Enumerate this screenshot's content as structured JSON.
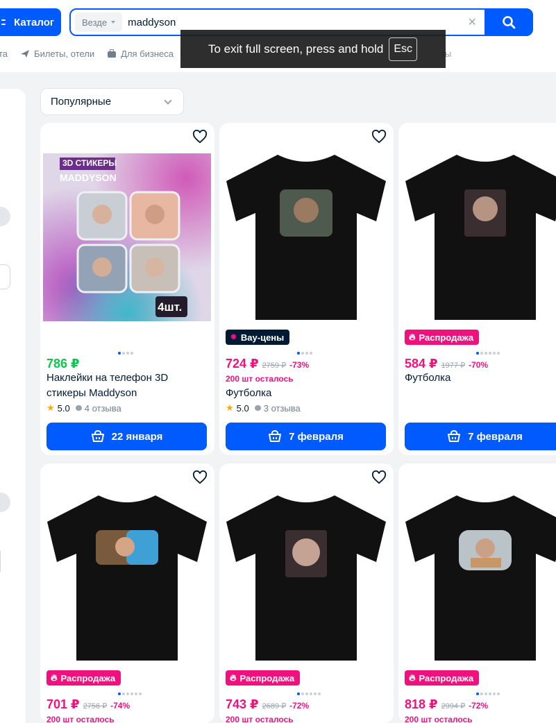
{
  "header": {
    "catalog_label": "Каталог",
    "search_scope": "Везде",
    "search_value": "maddyson"
  },
  "nav": {
    "items": [
      {
        "label": "та",
        "icon": "cut-off-item"
      },
      {
        "label": "Билеты, отели",
        "icon": "plane-icon"
      },
      {
        "label": "Для бизнеса",
        "icon": "briefcase-icon"
      }
    ],
    "far_right": "ты"
  },
  "overlay": {
    "message": "To exit full screen, press and hold",
    "key": "Esc"
  },
  "sort": {
    "label": "Популярные"
  },
  "cards": [
    {
      "price": "786 ₽",
      "title": "Наклейки на телефон 3D стикеры Maddyson",
      "rating": "5.0",
      "reviews": "4 отзыва",
      "delivery": "22 января",
      "image_title": "3D СТИКЕРЫ",
      "image_subtitle": "MADDYSON",
      "image_badge": "4шт."
    },
    {
      "badge": "Вау-цены",
      "price": "724 ₽",
      "old_price": "2759 ₽",
      "discount": "-73%",
      "stock": "200 шт осталось",
      "title": "Футболка",
      "rating": "5.0",
      "reviews": "3 отзыва",
      "delivery": "7 февраля"
    },
    {
      "badge": "Распродажа",
      "price": "584 ₽",
      "old_price": "1977 ₽",
      "discount": "-70%",
      "title": "Футболка",
      "delivery": "7 февраля"
    },
    {
      "badge": "Распродажа",
      "price": "701 ₽",
      "old_price": "2756 ₽",
      "discount": "-74%",
      "stock": "200 шт осталось"
    },
    {
      "badge": "Распродажа",
      "price": "743 ₽",
      "old_price": "2689 ₽",
      "discount": "-72%",
      "stock": "200 шт осталось"
    },
    {
      "badge": "Распродажа",
      "price": "818 ₽",
      "old_price": "2994 ₽",
      "discount": "-72%",
      "stock": "200 шт осталось"
    }
  ],
  "colors": {
    "accent": "#005bff",
    "sale": "#f1117e",
    "green_price": "#10c44c",
    "text": "#001a34",
    "muted": "#707f8d"
  }
}
